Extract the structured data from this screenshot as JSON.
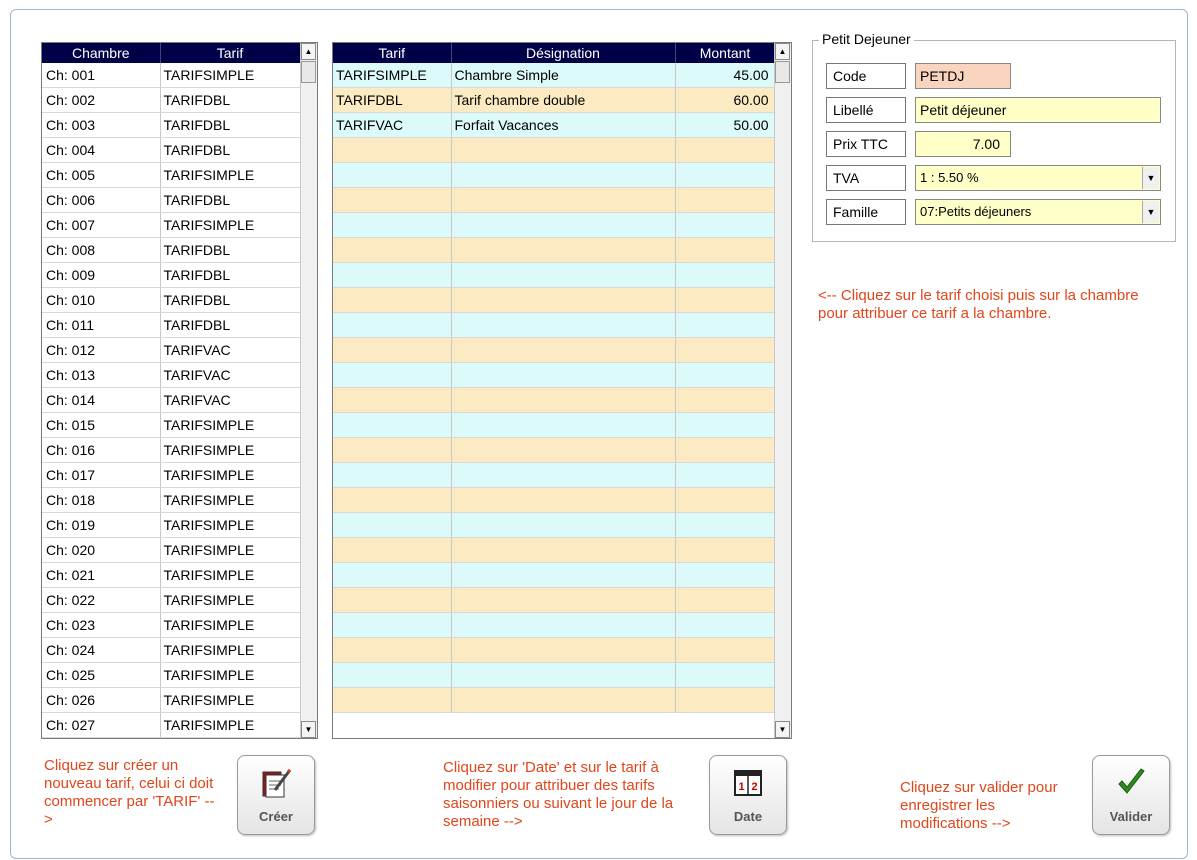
{
  "grid_rooms": {
    "headers": [
      "Chambre",
      "Tarif"
    ],
    "rows": [
      [
        "Ch: 001",
        "TARIFSIMPLE"
      ],
      [
        "Ch: 002",
        "TARIFDBL"
      ],
      [
        "Ch: 003",
        "TARIFDBL"
      ],
      [
        "Ch: 004",
        "TARIFDBL"
      ],
      [
        "Ch: 005",
        "TARIFSIMPLE"
      ],
      [
        "Ch: 006",
        "TARIFDBL"
      ],
      [
        "Ch: 007",
        "TARIFSIMPLE"
      ],
      [
        "Ch: 008",
        "TARIFDBL"
      ],
      [
        "Ch: 009",
        "TARIFDBL"
      ],
      [
        "Ch: 010",
        "TARIFDBL"
      ],
      [
        "Ch: 011",
        "TARIFDBL"
      ],
      [
        "Ch: 012",
        "TARIFVAC"
      ],
      [
        "Ch: 013",
        "TARIFVAC"
      ],
      [
        "Ch: 014",
        "TARIFVAC"
      ],
      [
        "Ch: 015",
        "TARIFSIMPLE"
      ],
      [
        "Ch: 016",
        "TARIFSIMPLE"
      ],
      [
        "Ch: 017",
        "TARIFSIMPLE"
      ],
      [
        "Ch: 018",
        "TARIFSIMPLE"
      ],
      [
        "Ch: 019",
        "TARIFSIMPLE"
      ],
      [
        "Ch: 020",
        "TARIFSIMPLE"
      ],
      [
        "Ch: 021",
        "TARIFSIMPLE"
      ],
      [
        "Ch: 022",
        "TARIFSIMPLE"
      ],
      [
        "Ch: 023",
        "TARIFSIMPLE"
      ],
      [
        "Ch: 024",
        "TARIFSIMPLE"
      ],
      [
        "Ch: 025",
        "TARIFSIMPLE"
      ],
      [
        "Ch: 026",
        "TARIFSIMPLE"
      ],
      [
        "Ch: 027",
        "TARIFSIMPLE"
      ]
    ]
  },
  "grid_tarifs": {
    "headers": [
      "Tarif",
      "Désignation",
      "Montant"
    ],
    "rows": [
      [
        "TARIFSIMPLE",
        "Chambre Simple",
        "45.00"
      ],
      [
        "TARIFDBL",
        "Tarif chambre double",
        "60.00"
      ],
      [
        "TARIFVAC",
        "Forfait Vacances",
        "50.00"
      ]
    ],
    "empty_rows": 23
  },
  "breakfast": {
    "title": "Petit Dejeuner",
    "code_label": "Code",
    "code_value": "PETDJ",
    "libelle_label": "Libellé",
    "libelle_value": "Petit déjeuner",
    "prix_label": "Prix TTC",
    "prix_value": "7.00",
    "tva_label": "TVA",
    "tva_value": "1 :  5.50 %",
    "famille_label": "Famille",
    "famille_value": "07:Petits déjeuners"
  },
  "notes": {
    "assign": "<-- Cliquez sur le tarif choisi puis sur la chambre pour attribuer ce tarif a la chambre.",
    "create": "Cliquez sur créer un nouveau tarif, celui ci doit commencer par 'TARIF' -->",
    "date": "Cliquez sur 'Date' et sur le tarif à modifier pour attribuer des tarifs saisonniers ou suivant le jour de la semaine -->",
    "validate": "Cliquez sur valider pour enregistrer les modifications -->"
  },
  "buttons": {
    "create_label": "Créer",
    "create_icon": "edit-document-icon",
    "date_label": "Date",
    "date_icon": "calendar-icon",
    "validate_label": "Valider",
    "validate_icon": "checkmark-icon"
  },
  "colors": {
    "header_bg": "#000048",
    "row_cyan": "#dcfafa",
    "row_yellow": "#fcebc2",
    "note_text": "#e0461b",
    "code_field_bg": "#f9d5c0",
    "field_bg": "#ffffc8"
  }
}
